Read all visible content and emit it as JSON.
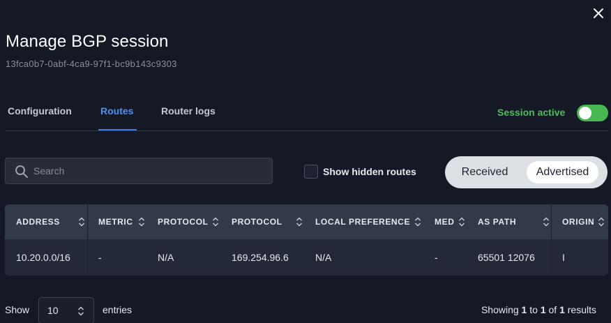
{
  "header": {
    "title": "Manage BGP session",
    "session_id": "13fca0b7-0abf-4ca9-97f1-bc9b143c9303"
  },
  "tabs": [
    {
      "label": "Configuration",
      "active": false
    },
    {
      "label": "Routes",
      "active": true
    },
    {
      "label": "Router logs",
      "active": false
    }
  ],
  "session": {
    "label": "Session active",
    "enabled": true
  },
  "search": {
    "placeholder": "Search",
    "value": ""
  },
  "hidden_routes": {
    "label": "Show hidden routes",
    "checked": false
  },
  "route_direction": {
    "options": [
      "Received",
      "Advertised"
    ],
    "selected": "Advertised"
  },
  "table": {
    "columns": [
      "ADDRESS",
      "METRIC",
      "PROTOCOL",
      "PROTOCOL",
      "LOCAL PREFERENCE",
      "MED",
      "AS PATH",
      "ORIGIN"
    ],
    "rows": [
      [
        "10.20.0.0/16",
        "-",
        "N/A",
        "169.254.96.6",
        "N/A",
        "-",
        "65501 12076",
        "I"
      ]
    ]
  },
  "pagination": {
    "show_label": "Show",
    "page_size": "10",
    "entries_label": "entries",
    "results": {
      "prefix": "Showing",
      "from": "1",
      "to_word": "to",
      "to": "1",
      "of_word": "of",
      "total": "1",
      "suffix": "results"
    }
  },
  "colors": {
    "background": "#141925",
    "accent": "#4c8ff7",
    "success": "#4bbf5a",
    "table_header": "#323a4a",
    "table_row": "#232936"
  },
  "icons": {
    "close": "close-icon",
    "search": "search-icon",
    "sort": "sort-icon",
    "select": "chevron-up-down-icon"
  }
}
